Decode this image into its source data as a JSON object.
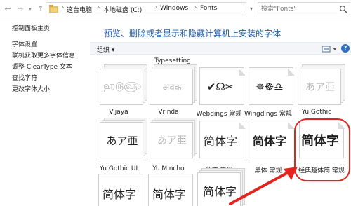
{
  "address_bar": {
    "crumbs": [
      "这台电脑",
      "本地磁盘 (C:)",
      "Windows",
      "Fonts"
    ],
    "search_placeholder": "搜索\"Fonts\""
  },
  "sidebar": {
    "links": [
      "控制面板主页",
      "字体设置",
      "联机获取更多字体信息",
      "调整 ClearType 文本",
      "查找字符",
      "更改字体大小"
    ]
  },
  "main": {
    "heading": "预览、删除或者显示和隐藏计算机上安装的字体",
    "organize_label": "组织 ▾",
    "help_glyph": "?",
    "partial_label": "Typesetting",
    "fonts": [
      {
        "sample": "ஹ௫௵",
        "caption": "Vijaya"
      },
      {
        "sample": "अवक",
        "caption": "Vrinda"
      },
      {
        "sample": "✔☊✂",
        "caption": "Webdings 常规"
      },
      {
        "sample": "✵☸♎",
        "caption": "Wingdings 常规"
      },
      {
        "sample": "あア亜",
        "caption": "Yu Gothic"
      },
      {
        "sample": "あア亜",
        "caption": "Yu Gothic UI"
      },
      {
        "sample": "あア亜",
        "caption": "Yu Mincho"
      },
      {
        "sample": "简体字",
        "caption": "仿宋 常规"
      },
      {
        "sample": "简体字",
        "caption": "黑体 常规"
      },
      {
        "sample": "简体字",
        "caption": "经典趣体简 常规"
      },
      {
        "sample": "简体字",
        "caption": ""
      },
      {
        "sample": "简体字",
        "caption": ""
      },
      {
        "sample": "简体字",
        "caption": ""
      }
    ]
  },
  "colors": {
    "heading": "#1e5aa8",
    "highlight": "#e2241e",
    "accent": "#2f6fc4"
  }
}
